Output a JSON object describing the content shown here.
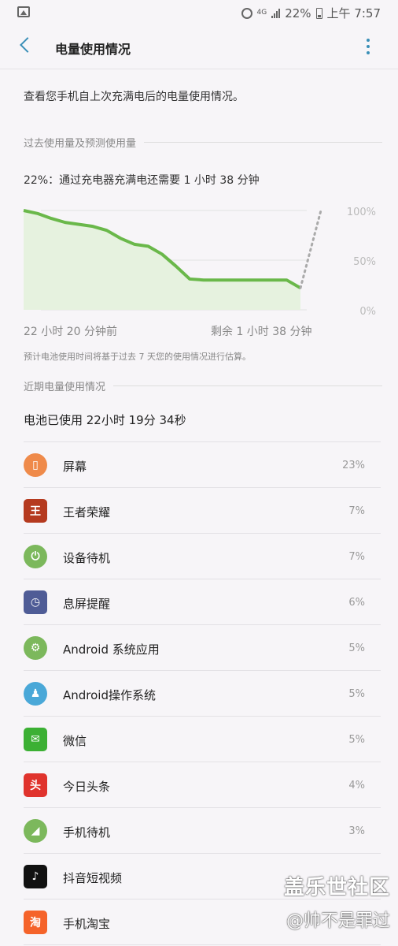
{
  "status": {
    "network": "4G",
    "battery": "22%",
    "time": "上午 7:57"
  },
  "appbar": {
    "title": "电量使用情况"
  },
  "intro": "查看您手机自上次充满电后的电量使用情况。",
  "section_past": "过去使用量及预测使用量",
  "charge_info": "22%：通过充电器充满电还需要 1 小时 38 分钟",
  "chart_data": {
    "type": "area",
    "y_ticks": [
      "100%",
      "50%",
      "0%"
    ],
    "ylim": [
      0,
      100
    ],
    "x_start_label": "22 小时 20 分钟前",
    "x_end_label": "剩余 1 小时 38 分钟",
    "series": [
      {
        "values": [
          100,
          97,
          92,
          88,
          86,
          84,
          80,
          72,
          66,
          64,
          56,
          44,
          31,
          30,
          30,
          30,
          30,
          30,
          30,
          30,
          22
        ]
      }
    ],
    "forecast": [
      22,
      100
    ],
    "colors": {
      "line": "#6ab84a",
      "fill": "#e6f2df",
      "forecast": "#aaaaaa"
    }
  },
  "note": "预计电池使用时间将基于过去 7 天您的使用情况进行估算。",
  "section_recent": "近期电量使用情况",
  "usage_title": "电池已使用 22小时 19分 34秒",
  "apps": [
    {
      "name": "屏幕",
      "percent": "23%",
      "icon": "screen-icon",
      "color": "#ef8a4a",
      "glyph": "▯"
    },
    {
      "name": "王者荣耀",
      "percent": "7%",
      "icon": "honor-of-kings-icon",
      "color": "#b53a1f",
      "glyph": "王"
    },
    {
      "name": "设备待机",
      "percent": "7%",
      "icon": "power-icon",
      "color": "#7cb85c",
      "glyph": "⏻"
    },
    {
      "name": "息屏提醒",
      "percent": "6%",
      "icon": "always-on-display-icon",
      "color": "#4f5c96",
      "glyph": "◷"
    },
    {
      "name": "Android 系统应用",
      "percent": "5%",
      "icon": "android-system-icon",
      "color": "#7cb85c",
      "glyph": "⚙"
    },
    {
      "name": "Android操作系统",
      "percent": "5%",
      "icon": "android-robot-icon",
      "color": "#4aa8d8",
      "glyph": "♟"
    },
    {
      "name": "微信",
      "percent": "5%",
      "icon": "wechat-icon",
      "color": "#3cb034",
      "glyph": "✉"
    },
    {
      "name": "今日头条",
      "percent": "4%",
      "icon": "toutiao-icon",
      "color": "#e0332d",
      "glyph": "头"
    },
    {
      "name": "手机待机",
      "percent": "3%",
      "icon": "cell-standby-icon",
      "color": "#7cb85c",
      "glyph": "◢"
    },
    {
      "name": "抖音短视频",
      "percent": "",
      "icon": "douyin-icon",
      "color": "#111111",
      "glyph": "♪"
    },
    {
      "name": "手机淘宝",
      "percent": "",
      "icon": "taobao-icon",
      "color": "#f5632a",
      "glyph": "淘"
    }
  ],
  "watermark": {
    "line1": "盖乐世社区",
    "line2": "@帅不是罪过"
  }
}
